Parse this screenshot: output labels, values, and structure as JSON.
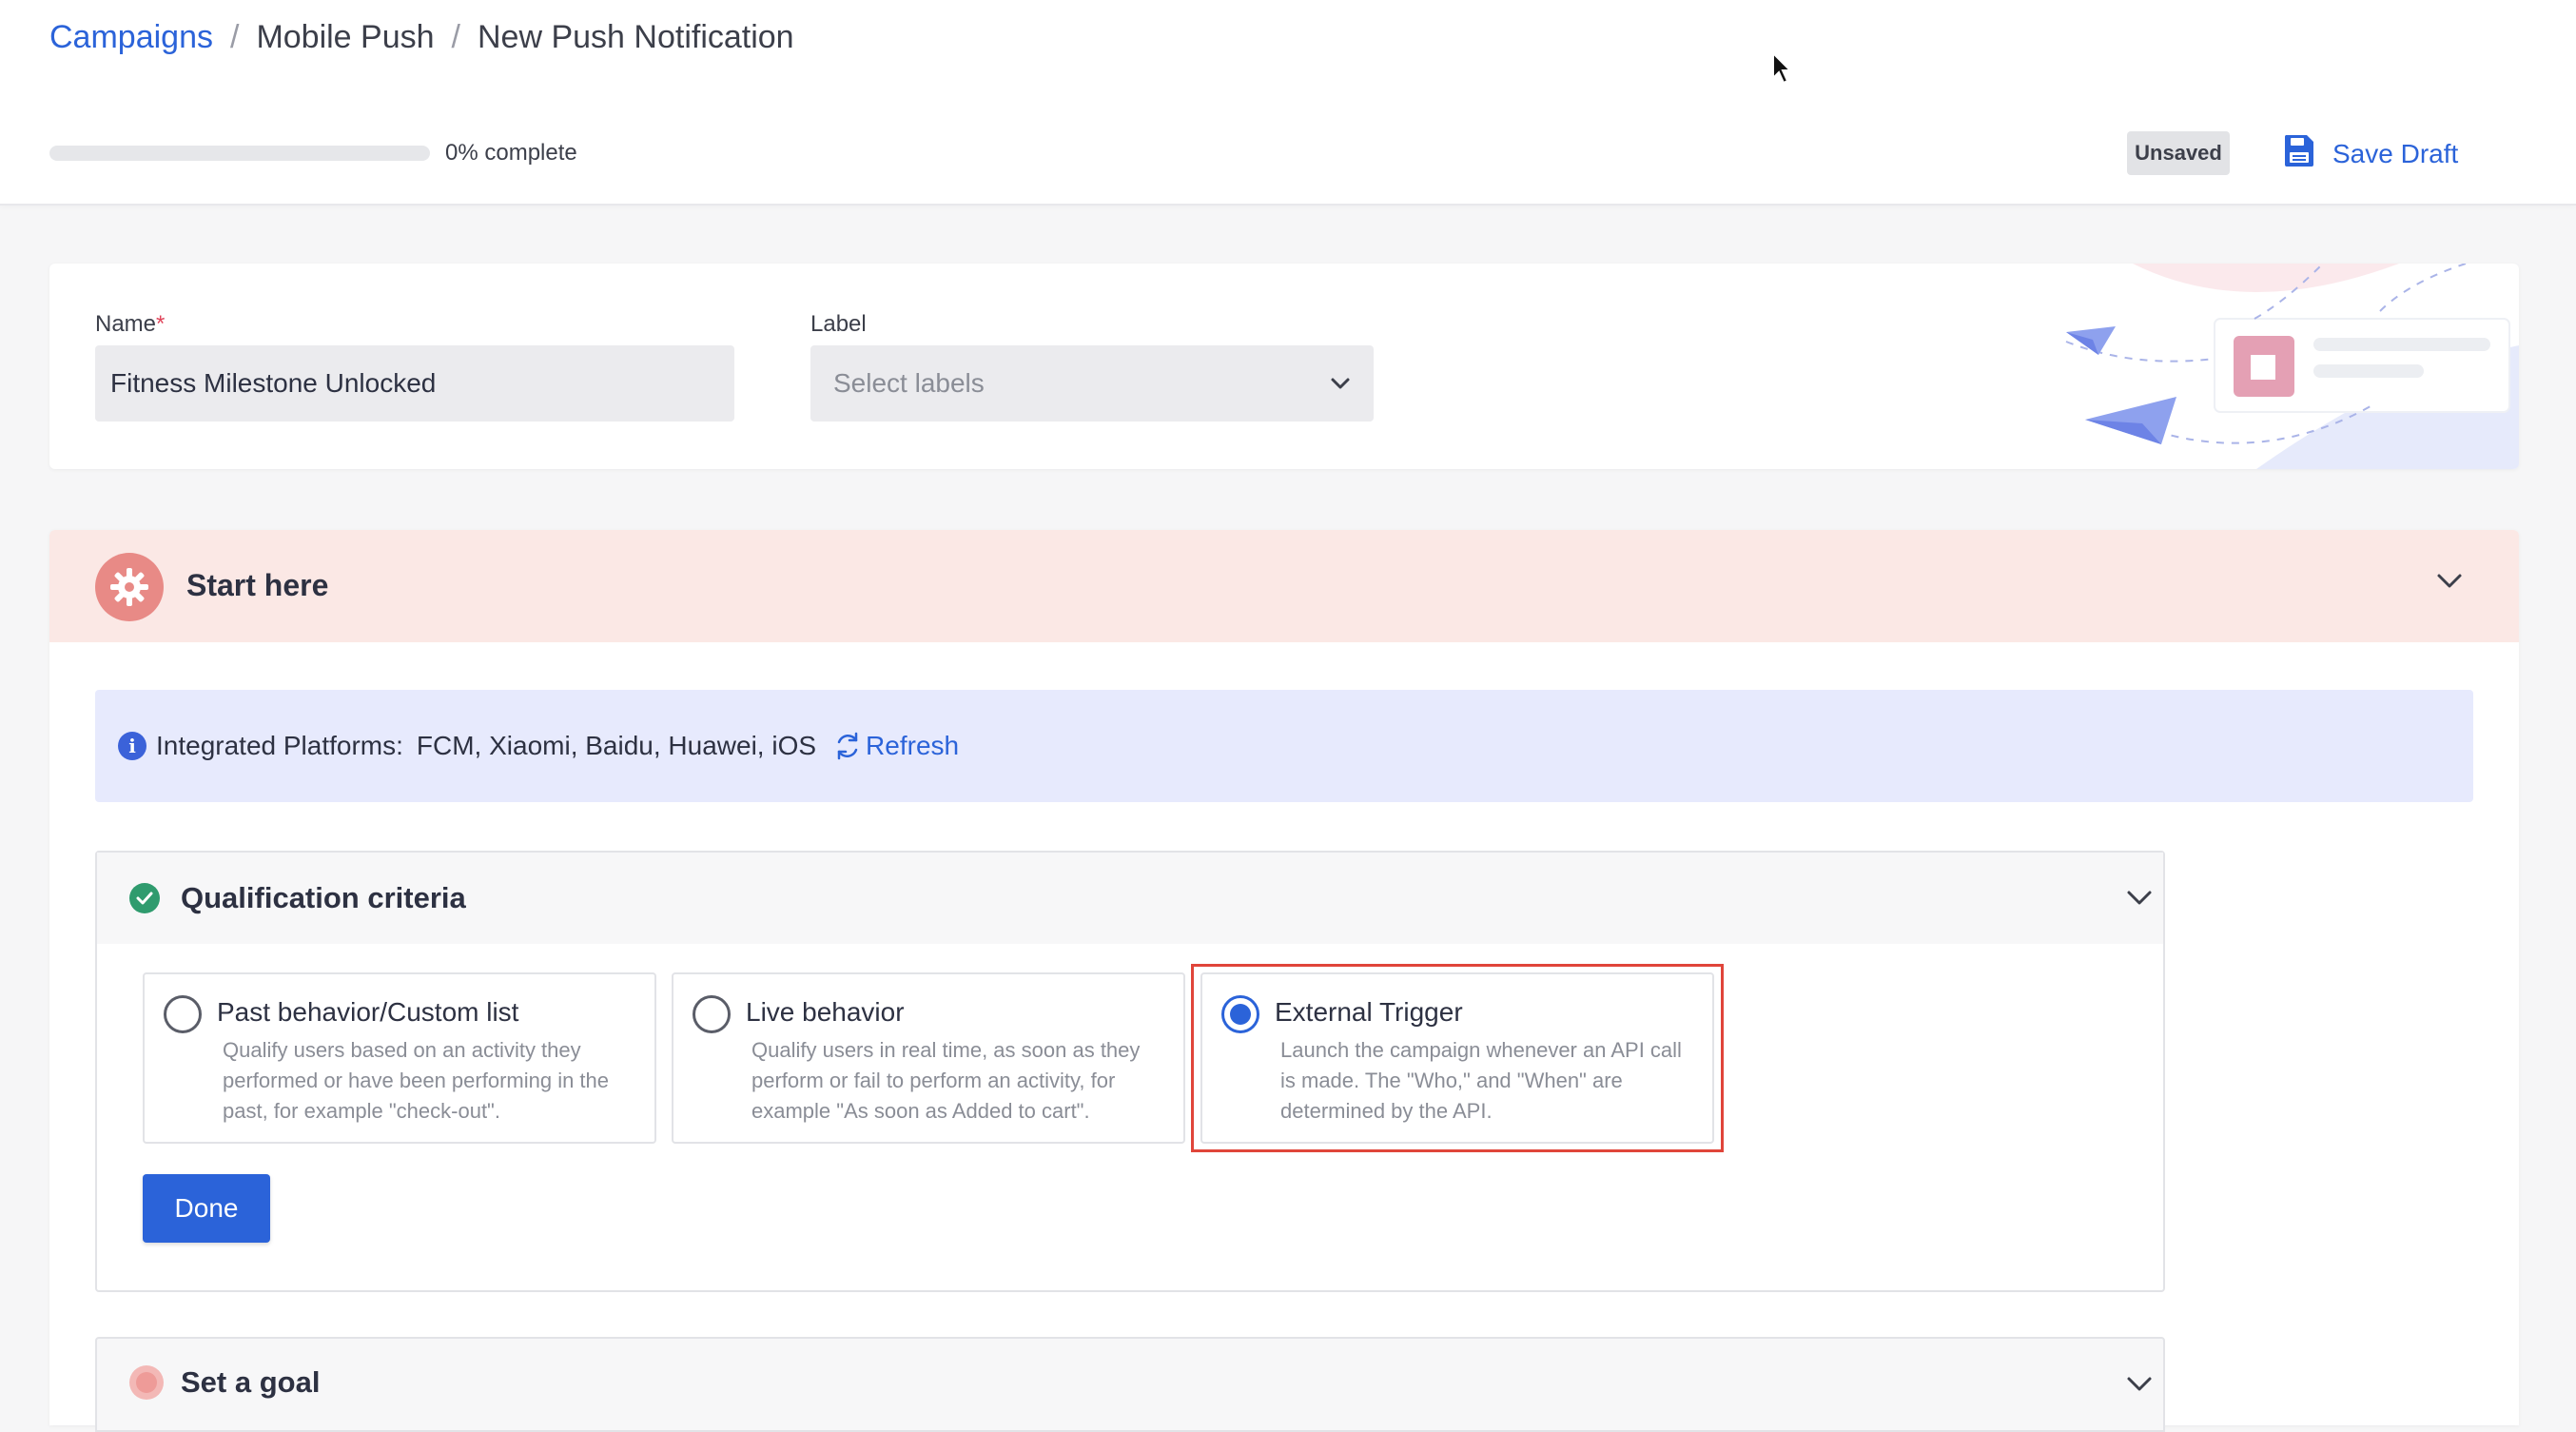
{
  "breadcrumb": {
    "root": "Campaigns",
    "middle": "Mobile Push",
    "current": "New Push Notification",
    "separator": "/"
  },
  "progress": {
    "percent": 0,
    "label": "0% complete"
  },
  "status": {
    "badge": "Unsaved"
  },
  "actions": {
    "save_draft": "Save Draft"
  },
  "form": {
    "name_label": "Name",
    "required_mark": "*",
    "name_value": "Fitness Milestone Unlocked",
    "label_label": "Label",
    "label_placeholder": "Select labels"
  },
  "start": {
    "title": "Start here",
    "banner": {
      "key": "Integrated Platforms:",
      "value": "FCM, Xiaomi, Baidu, Huawei, iOS",
      "refresh": "Refresh",
      "info_glyph": "i"
    }
  },
  "qualification": {
    "title": "Qualification criteria",
    "options": [
      {
        "title": "Past behavior/Custom list",
        "desc": "Qualify users based on an activity they performed or have been performing in the past, for example \"check-out\".",
        "selected": false
      },
      {
        "title": "Live behavior",
        "desc": "Qualify users in real time, as soon as they perform or fail to perform an activity, for example \"As soon as Added to cart\".",
        "selected": false
      },
      {
        "title": "External Trigger",
        "desc": "Launch the campaign whenever an API call is made. The \"Who,\" and \"When\" are determined by the API.",
        "selected": true
      }
    ],
    "done": "Done"
  },
  "goal": {
    "title": "Set a goal"
  },
  "colors": {
    "accent": "#2b63d9",
    "success": "#2f9b6e",
    "highlight": "#e0453a",
    "start_bg": "#fbe8e5",
    "banner_bg": "#e7eafd"
  },
  "icons": [
    "save-icon",
    "chevron-down-icon",
    "gear-icon",
    "info-icon",
    "refresh-icon",
    "check-icon",
    "paper-plane-icon",
    "cursor-icon"
  ]
}
